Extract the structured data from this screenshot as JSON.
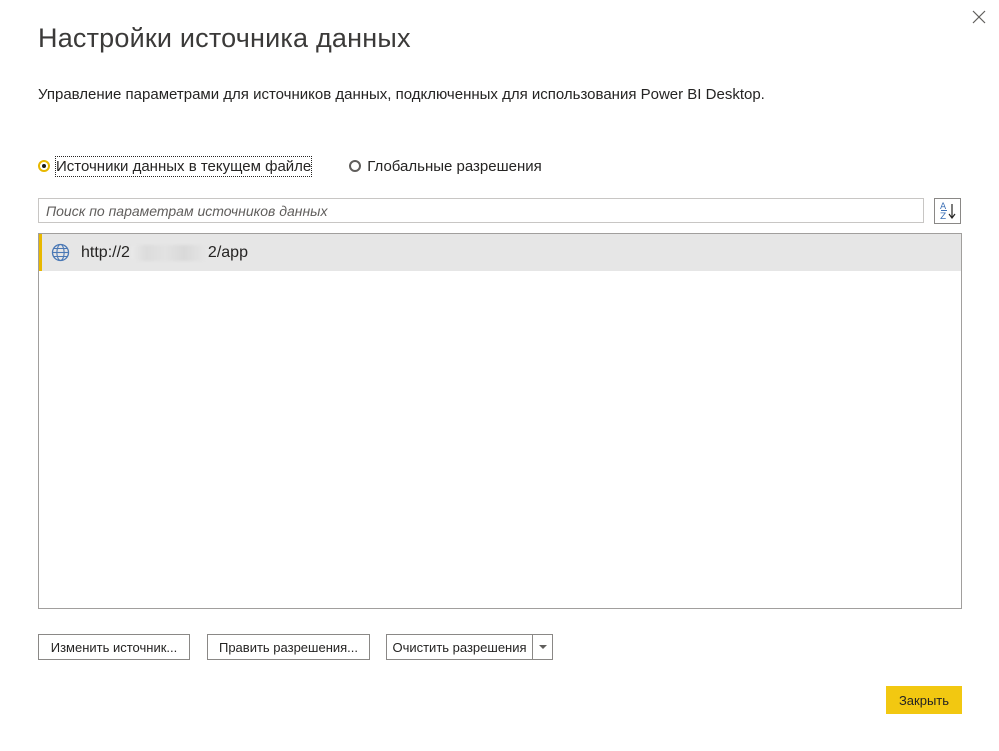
{
  "dialog": {
    "title": "Настройки источника данных",
    "subtitle": "Управление параметрами для источников данных, подключенных для использования Power BI Desktop.",
    "close_icon": "close-x-icon"
  },
  "scope": {
    "options": [
      {
        "label": "Источники данных в текущем файле",
        "selected": true
      },
      {
        "label": "Глобальные разрешения",
        "selected": false
      }
    ]
  },
  "search": {
    "placeholder": "Поиск по параметрам источников данных",
    "value": "",
    "sort_icon": "sort-az-icon"
  },
  "sources": {
    "items": [
      {
        "icon": "globe-icon",
        "text_start": "http://2",
        "text_end": "2/app",
        "selected": true
      }
    ]
  },
  "buttons": {
    "edit_source": "Изменить источник...",
    "edit_permissions": "Править разрешения...",
    "clear_permissions": "Очистить разрешения",
    "close": "Закрыть"
  },
  "colors": {
    "accent": "#f2c811",
    "selection_bar": "#e8b800",
    "selected_row": "#e6e6e6"
  }
}
